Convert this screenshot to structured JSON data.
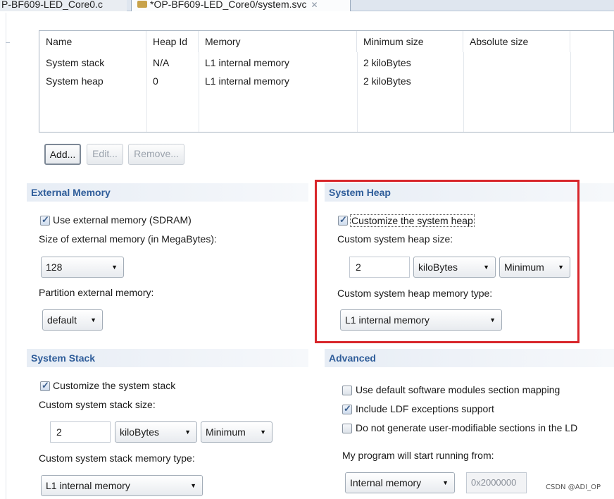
{
  "tabs": [
    {
      "label": "P-BF609-LED_Core0.c"
    },
    {
      "label": "*OP-BF609-LED_Core0/system.svc"
    }
  ],
  "table": {
    "columns": [
      "Name",
      "Heap Id",
      "Memory",
      "Minimum size",
      "Absolute size"
    ],
    "rows": [
      [
        "System stack",
        "N/A",
        "L1 internal memory",
        "2 kiloBytes",
        ""
      ],
      [
        "System heap",
        "0",
        "L1 internal memory",
        "2 kiloBytes",
        ""
      ]
    ]
  },
  "buttons": {
    "add": "Add...",
    "edit": "Edit...",
    "remove": "Remove..."
  },
  "external_memory": {
    "title": "External Memory",
    "use_checkbox_label": "Use external memory (SDRAM)",
    "use_checked": true,
    "size_label": "Size of external memory (in MegaBytes):",
    "size_value": "128",
    "partition_label": "Partition external memory:",
    "partition_value": "default"
  },
  "system_heap": {
    "title": "System Heap",
    "customize_label": "Customize the system heap",
    "customize_checked": true,
    "size_label": "Custom system heap size:",
    "size_value": "2",
    "unit_value": "kiloBytes",
    "mode_value": "Minimum",
    "memtype_label": "Custom system heap memory type:",
    "memtype_value": "L1 internal memory"
  },
  "system_stack": {
    "title": "System Stack",
    "customize_label": "Customize the system stack",
    "customize_checked": true,
    "size_label": "Custom system stack size:",
    "size_value": "2",
    "unit_value": "kiloBytes",
    "mode_value": "Minimum",
    "memtype_label": "Custom system stack memory type:",
    "memtype_value": "L1 internal memory"
  },
  "advanced": {
    "title": "Advanced",
    "default_sw_label": "Use default software modules section mapping",
    "default_sw_checked": false,
    "ldf_exceptions_label": "Include LDF exceptions support",
    "ldf_exceptions_checked": true,
    "no_user_sections_label": "Do not generate user-modifiable sections in the LD",
    "no_user_sections_checked": false,
    "start_label": "My program will start running from:",
    "start_value": "Internal memory",
    "address_value": "0x2000000"
  },
  "watermark": "CSDN @ADI_OP",
  "colors": {
    "highlight_box": "#d8262b",
    "section_title": "#2f5d9a"
  }
}
